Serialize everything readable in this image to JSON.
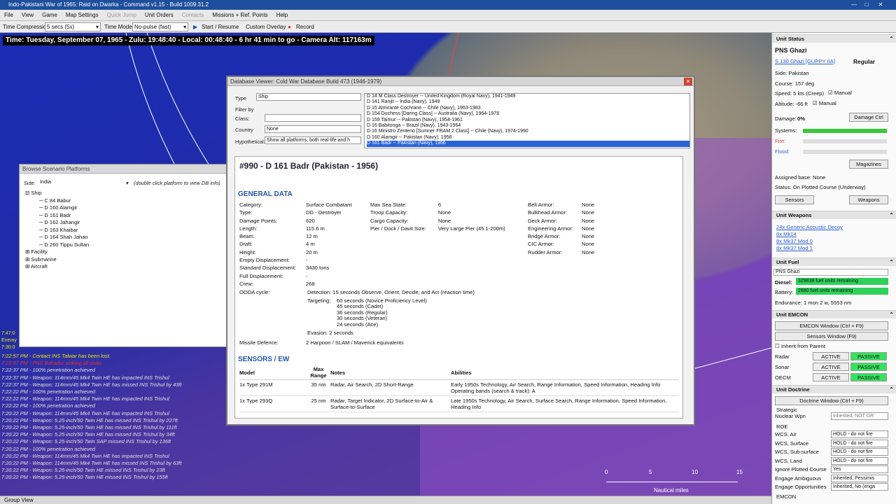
{
  "window": {
    "title": "Indo-Pakistani War of 1965: Raid on Dwarka - Command v1.15 - Build 1009.31.2"
  },
  "menu": [
    "File",
    "View",
    "Game",
    "Map Settings",
    "Quick Jump",
    "Unit Orders",
    "Contacts",
    "Missions + Ref. Points",
    "Help"
  ],
  "toolbar": {
    "time_compression_label": "Time Compression:",
    "time_compression_value": "5 secs (5x)",
    "time_mode_label": "Time Mode:",
    "time_mode_value": "No-pulse (fast)",
    "start_label": "Start / Resume",
    "overlay_label": "Custom Overlay",
    "record_label": "Record"
  },
  "map": {
    "time_text": "Time: Tuesday, September 07, 1965 - Zulu: 19:48:40 - Local: 00:48:40 - 6 hr 41 min to go -  Camera Alt: 117163m",
    "scale_ticks": [
      "0",
      "5",
      "10",
      "15"
    ],
    "scale_unit": "Nautical miles",
    "messages": [
      {
        "text": "7:22:57 PM - Contact INS Talwar has been lost.",
        "color": "#e8e800"
      },
      {
        "text": "7:22:57 PM - PNS Bahadur sinking all sinks",
        "color": "#e83030"
      },
      {
        "text": "7:22:37 PM - 100% penetration achieved",
        "color": "#e0e0e0"
      },
      {
        "text": "7:22:37 PM - Weapon: 114mm/45 Mk4 Twin HE has impacted INS Trishul",
        "color": "#e0e0e0"
      },
      {
        "text": "7:22:37 PM - Weapon: 114mm/45 Mk4 Twin HE has missed INS Trishul by 43ft",
        "color": "#e0e0e0"
      },
      {
        "text": "7:22:22 PM - 100% penetration achieved",
        "color": "#e0e0e0"
      },
      {
        "text": "7:22:22 PM - Weapon: 114mm/45 Mk4 Twin HE has impacted INS Trishul",
        "color": "#e0e0e0"
      },
      {
        "text": "7:22:22 PM - 100% penetration achieved",
        "color": "#e0e0e0"
      },
      {
        "text": "7:20:22 PM - Weapon: 114mm/45 Mk4 Twin HE has impacted INS Trishul",
        "color": "#e0e0e0"
      },
      {
        "text": "7:20:22 PM - Weapon: 5.25-inch/50 Twin HE has missed INS Trishul by 227ft",
        "color": "#e0e0e0"
      },
      {
        "text": "7:20:22 PM - Weapon: 5.25-inch/50 Twin HE has missed INS Trishul by 111ft",
        "color": "#e0e0e0"
      },
      {
        "text": "7:20:22 PM - Weapon: 5.25-inch/50 Twin HE has missed INS Trishul by 34ft",
        "color": "#e0e0e0"
      },
      {
        "text": "7:20:22 PM - Weapon: 5.25-inch/50 Twin SAP missed INS Trishul by 136ft",
        "color": "#e0e0e0"
      },
      {
        "text": "7:20:22 PM - 100% penetration achieved",
        "color": "#e0e0e0"
      },
      {
        "text": "7:20:22 PM - Weapon: 114mm/45 Mk4 Twin HE has impacted INS Trishul",
        "color": "#e0e0e0"
      },
      {
        "text": "7:20:22 PM - Weapon: 114mm/45 Mk4 Twin HE has missed INS Trishul by 63ft",
        "color": "#e0e0e0"
      },
      {
        "text": "7:20:22 PM - Weapon: 5.25-inch/50 Twin HE missed INS Trishul by 23ft",
        "color": "#e0e0e0"
      },
      {
        "text": "7:20:22 PM - Weapon: 5.25-inch/50 Twin HE missed INS Trishul by 155ft",
        "color": "#e0e0e0"
      }
    ],
    "left_times": [
      "7:47:0",
      "Enemy",
      "7:30:0"
    ],
    "status_bar": "Group View"
  },
  "browse": {
    "title": "Browse Scenario Platforms",
    "side_label": "Side:",
    "side_value": "India",
    "hint": "(double click platform to view DB info)",
    "tree": [
      {
        "t": "Ship",
        "lvl": 0,
        "exp": "⊟"
      },
      {
        "t": "C 84 Babur",
        "lvl": 1
      },
      {
        "t": "D 160 Alamgir",
        "lvl": 1
      },
      {
        "t": "D 161 Badr",
        "lvl": 1
      },
      {
        "t": "D 162 Jahangir",
        "lvl": 1
      },
      {
        "t": "D 163 Khaibar",
        "lvl": 1
      },
      {
        "t": "D 164 Shah Jahan",
        "lvl": 1
      },
      {
        "t": "D 260 Tippu Sultan",
        "lvl": 1
      },
      {
        "t": "Facility",
        "lvl": 0,
        "exp": "⊞"
      },
      {
        "t": "Submarine",
        "lvl": 0,
        "exp": "⊞"
      },
      {
        "t": "Aircraft",
        "lvl": 0,
        "exp": "⊞"
      }
    ]
  },
  "dbv": {
    "title": "Database Viewer: Cold War Database Build 473 (1946-1979)",
    "type_label": "Type",
    "type_value": "Ship",
    "filter_label": "Filter by",
    "class_label": "Class:",
    "country_label": "Country",
    "country_value": "None",
    "hypo_label": "Hypothetical:",
    "hypo_value": "Show all platforms, both real-life and h",
    "list": [
      "D 14 M Class Destroyer -- United Kingdom (Royal Navy), 1941-1949",
      "D 141 Ranjit -- India (Navy), 1949",
      "D 15 Almirante Cochrane -- Chile (Navy), 1963-1983",
      "D 154 Duchess [Daring Class] -- Australia (Navy), 1964-1978",
      "D 159 Taimur -- Pakistan (Navy), 1954-1961",
      "D 16 Babitonga -- Brazil (Navy), 1943-1964",
      "D 16 Ministro Zenteno [Sumner FRAM 2 Class] -- Chile (Navy), 1974-1990",
      "D 160 Alamgir -- Pakistan (Navy), 1956",
      "D 161 Badr -- Pakistan (Navy), 1956"
    ],
    "heading": "#990 - D 161 Badr (Pakistan - 1956)",
    "general": "GENERAL DATA",
    "sensors": "SENSORS / EW",
    "col1": [
      [
        "Category:",
        "Surface Combatant"
      ],
      [
        "Type:",
        "DD - Destroyer"
      ],
      [
        "Damage Points:",
        "620"
      ],
      [
        "Length:",
        "115.6 m"
      ],
      [
        "Beam:",
        "12 m"
      ],
      [
        "Draft:",
        "4 m"
      ],
      [
        "Height:",
        "20 m"
      ],
      [
        "Empty Displacement:",
        "-"
      ],
      [
        "Standard Displacement:",
        "3430 tons"
      ],
      [
        "Full Displacement:",
        "-"
      ],
      [
        "Crew:",
        "268"
      ]
    ],
    "col2": [
      [
        "Max Sea State:",
        "6"
      ],
      [
        "Troop Capacity:",
        "None"
      ],
      [
        "Cargo Capacity:",
        "None"
      ],
      [
        "Pier / Dock / Davit Size:",
        "Very Large Pier (45.1-200m)"
      ]
    ],
    "col3": [
      [
        "Belt Armor:",
        "None"
      ],
      [
        "Bulkhead Armor:",
        "None"
      ],
      [
        "Deck Armor:",
        "None"
      ],
      [
        "Engineering Armor:",
        "None"
      ],
      [
        "Bridge Armor:",
        "None"
      ],
      [
        "CIC Armor:",
        "None"
      ],
      [
        "Rudder Armor:",
        "None"
      ]
    ],
    "ooda_label": "OODA cycle:",
    "ooda_detection": "Detection: 15 seconds Observe, Orient, Decide, and Act (reaction time)",
    "ooda_targeting_label": "Targeting:",
    "ooda_targeting": [
      "60 seconds (Novice Proficiency Level)",
      "45 seconds (Cadet)",
      "36 seconds (Regular)",
      "30 seconds (Veteran)",
      "24 seconds (Ace)"
    ],
    "ooda_evasion": "Evasion:   2 seconds",
    "missile_label": "Missile Defence:",
    "missile_value": "2 Harpoon / SLAM / Maverick equivalents",
    "table_headers": [
      "Model",
      "Max Range",
      "Notes",
      "Abilities"
    ],
    "table_rows": [
      [
        "1x Type 291M",
        "35 nm",
        "Radar, Air Search, 2D Short-Range",
        "Early 1950s Technology, Air Search, Range Information, Speed Information, Heading Info  Operating bands (search & track): A"
      ],
      [
        "1x Type 293Q",
        "25 nm",
        "Radar, Target Indicator, 2D Surface-to-Air & Surface-to-Surface",
        "Late 1950s Technology, Air Search, Surface Search, Range Information, Speed Information, Heading Info"
      ]
    ]
  },
  "side": {
    "status_header": "Unit Status",
    "unit_name": "PNS Ghazi",
    "unit_class": "S 130 Ghazi [GUPPY IIA]",
    "proficiency": "Regular",
    "side": "Side: Pakistan",
    "course": "Course: 157 deg",
    "speed": "Speed: 5 kts (Creep)",
    "altitude": "Altitude: -66 ft",
    "manual": "Manual",
    "damage_label": "Damage:",
    "damage_value": "0%",
    "damage_ctrl": "Damage Ctrl",
    "systems": "Systems:",
    "fire": "Fire:",
    "flood": "Flood:",
    "magazines": "Magazines",
    "assigned": "Assigned base: None",
    "status": "Status: On Plotted Course (Underway)",
    "sensors_btn": "Sensors",
    "weapons_btn": "Weapons",
    "weapons_header": "Unit Weapons",
    "weapons": [
      "24x Generic Acoustic Decoy",
      "8x Mk14",
      "8x Mk37 Mod 0",
      "8x Mk37 Mod 1"
    ],
    "fuel_header": "Unit Fuel",
    "fuel_unit": "PNS Ghazi",
    "diesel_label": "Diesel:",
    "diesel_value": "329838 fuel units remaining",
    "battery_label": "Battery:",
    "battery_value": "2880 fuel units remaining",
    "endurance": "Endurance: 1 mon 2 w, 5553 nm",
    "emcon_header": "Unit EMCON",
    "emcon_btn": "EMCON Window (Ctrl + F9)",
    "sensors_window": "Sensors Window (F9)",
    "inherit": "Inherit from Parent",
    "emcon_rows": [
      {
        "name": "Radar",
        "a": "ACTIVE",
        "p": "PASSIVE",
        "on": "p"
      },
      {
        "name": "Sonar",
        "a": "ACTIVE",
        "p": "PASSIVE",
        "on": "p"
      },
      {
        "name": "OECM",
        "a": "ACTIVE",
        "p": "PASSIVE",
        "on": "p"
      }
    ],
    "doctrine_header": "Unit Doctrine",
    "doctrine_btn": "Doctrine Window (Ctrl + F9)",
    "strategic": "Strategic",
    "nuclear_label": "Nuclear Wpn",
    "nuclear_value": "Inherited, NOT GR",
    "roe": "ROE",
    "doctrine_rows": [
      [
        "WCS, Air",
        "HOLD - do not fire"
      ],
      [
        "WCS, Surface",
        "HOLD - do not fire"
      ],
      [
        "WCS, Sub-surface",
        "HOLD - do not fire"
      ],
      [
        "WCS, Land",
        "HOLD - do not fire"
      ],
      [
        "Ignore Plotted Course",
        "Yes"
      ],
      [
        "Engage Ambiguous",
        "Inherited, Pessimis"
      ],
      [
        "Engage Opportunities",
        "Inherited, No (enga"
      ]
    ],
    "emcon_footer": "EMCON"
  }
}
